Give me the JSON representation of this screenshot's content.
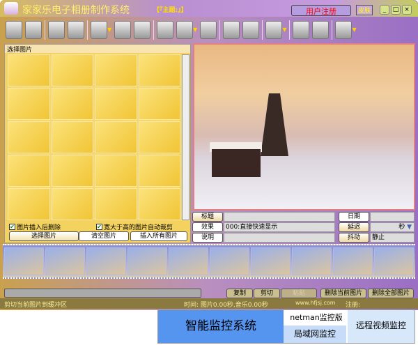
{
  "title": {
    "app": "家家乐电子相册制作系统",
    "theme": "【『主题:』】",
    "register": "用户注册",
    "skin": "皮肤"
  },
  "left": {
    "header": "选择图片",
    "chk1": "图片插入后删除",
    "chk2": "宽大于高的图片自动裁剪",
    "btn_select": "选择图片",
    "btn_clear": "清空图片",
    "btn_insert_all": "插入所有图片"
  },
  "fields": {
    "title_label": "标题",
    "effect_label": "效果",
    "effect_value": "000:直接快速显示",
    "desc_label": "说明",
    "date_label": "日期",
    "delay_label": "延迟",
    "delay_unit": "秒",
    "shake_label": "抖动",
    "shake_value": "静止"
  },
  "bottom": {
    "copy": "复制",
    "cut": "剪切",
    "paste": "粘贴",
    "delete_current": "删除当前图片",
    "delete_all": "删除全部图片"
  },
  "status": {
    "msg": "剪切当前图片到缓冲区",
    "time": "时间: 图片0.00秒,音乐0.00秒",
    "site": "www.hfjsj.com",
    "reg": "注册:"
  },
  "ad": {
    "main": "智能监控系统",
    "netman": "netman监控版",
    "lan": "局域网监控",
    "remote": "远程视频监控"
  }
}
